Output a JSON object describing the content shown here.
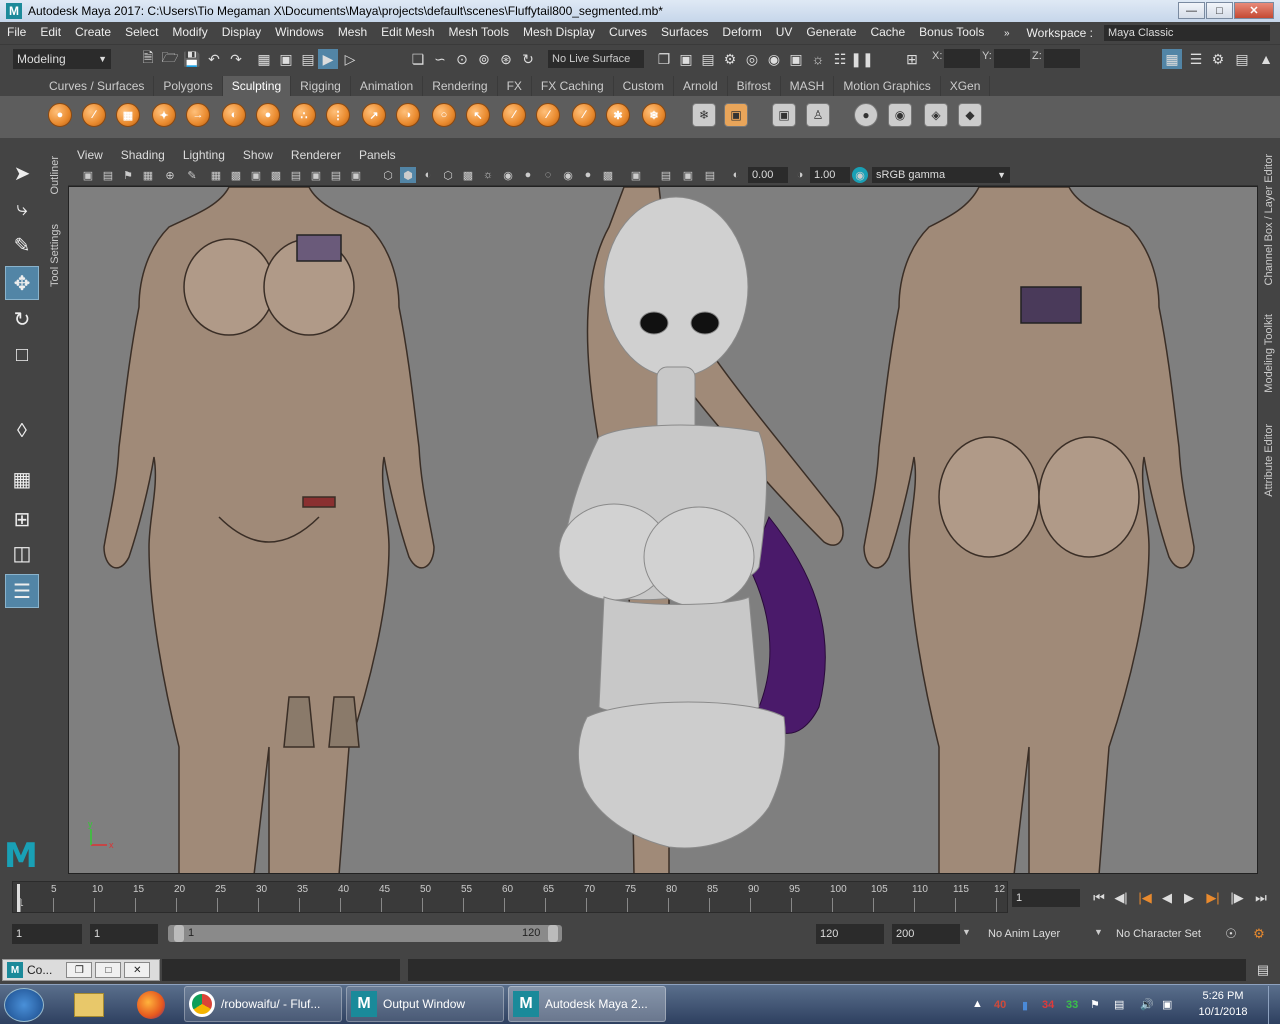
{
  "window": {
    "title": "Autodesk Maya 2017: C:\\Users\\Tio Megaman X\\Documents\\Maya\\projects\\default\\scenes\\Fluffytail800_segmented.mb*",
    "app_icon": "M"
  },
  "menu": [
    "File",
    "Edit",
    "Create",
    "Select",
    "Modify",
    "Display",
    "Windows",
    "Mesh",
    "Edit Mesh",
    "Mesh Tools",
    "Mesh Display",
    "Curves",
    "Surfaces",
    "Deform",
    "UV",
    "Generate",
    "Cache",
    "Bonus Tools"
  ],
  "workspace": {
    "label": "Workspace :",
    "value": "Maya Classic"
  },
  "status": {
    "mode": "Modeling",
    "live_surface": "No Live Surface",
    "x_label": "X:",
    "y_label": "Y:",
    "z_label": "Z:"
  },
  "shelf_tabs": [
    "Curves / Surfaces",
    "Polygons",
    "Sculpting",
    "Rigging",
    "Animation",
    "Rendering",
    "FX",
    "FX Caching",
    "Custom",
    "Arnold",
    "Bifrost",
    "MASH",
    "Motion Graphics",
    "XGen"
  ],
  "active_shelf": "Sculpting",
  "side_tabs_left": [
    "Outliner",
    "Tool Settings"
  ],
  "side_tabs_right": [
    "Channel Box / Layer Editor",
    "Modeling Toolkit",
    "Attribute Editor"
  ],
  "panel_menu": [
    "View",
    "Shading",
    "Lighting",
    "Show",
    "Renderer",
    "Panels"
  ],
  "panel_tools": {
    "exposure": "0.00",
    "gamma": "1.00",
    "color_space": "sRGB gamma"
  },
  "viewport": {
    "axis_x": "x",
    "axis_y": "y",
    "logo": "M"
  },
  "timeline": {
    "ticks": [
      "1",
      "5",
      "10",
      "15",
      "20",
      "25",
      "30",
      "35",
      "40",
      "45",
      "50",
      "55",
      "60",
      "65",
      "70",
      "75",
      "80",
      "85",
      "90",
      "95",
      "100",
      "105",
      "110",
      "115",
      "12"
    ],
    "current_frame": "1"
  },
  "range": {
    "start": "1",
    "anim_start": "1",
    "slider_start": "1",
    "slider_end": "120",
    "anim_end": "120",
    "end": "200",
    "anim_layer": "No Anim Layer",
    "character_set": "No Character Set"
  },
  "cmd": {
    "tab_label": "Co..."
  },
  "taskbar": {
    "items": [
      {
        "label": "/robowaifu/ - Fluf..."
      },
      {
        "label": "Output Window"
      },
      {
        "label": "Autodesk Maya 2..."
      }
    ],
    "tray": [
      "40",
      "34",
      "33"
    ],
    "time": "5:26 PM",
    "date": "10/1/2018"
  },
  "colors": {
    "accent": "#5285a6",
    "shelf_orange": "#e98a2e",
    "viewport_bg": "#7f7f7f"
  }
}
